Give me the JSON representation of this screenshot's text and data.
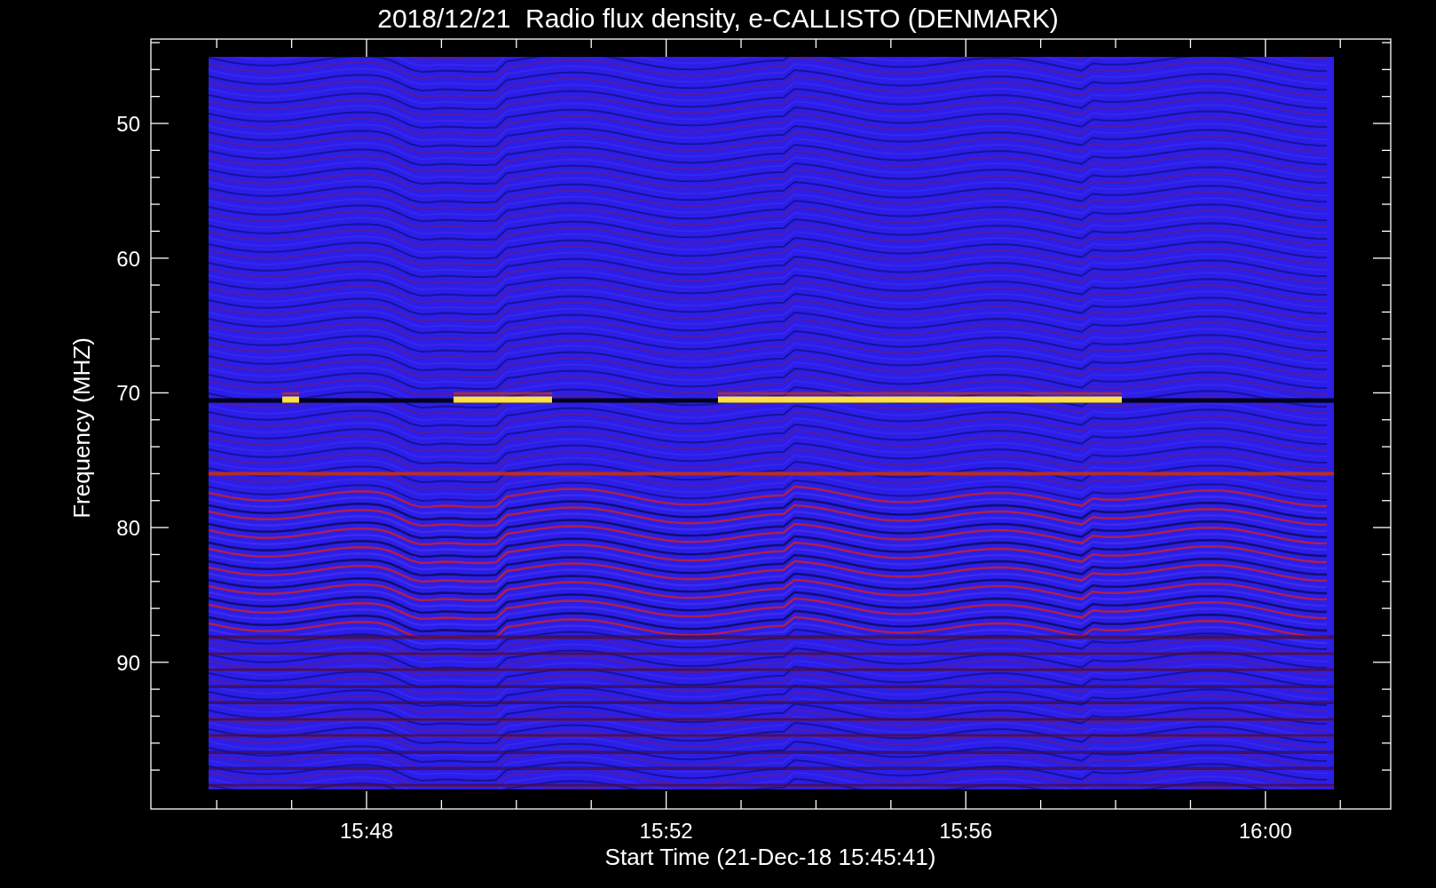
{
  "title": "2018/12/21  Radio flux density, e-CALLISTO (DENMARK)",
  "y_axis": {
    "label": "Frequency (MHZ)",
    "ticks": [
      "50",
      "60",
      "70",
      "80",
      "90"
    ]
  },
  "x_axis": {
    "label": "Start Time (21-Dec-18 15:45:41)",
    "ticks": [
      "15:48",
      "15:52",
      "15:56",
      "16:00"
    ]
  }
}
